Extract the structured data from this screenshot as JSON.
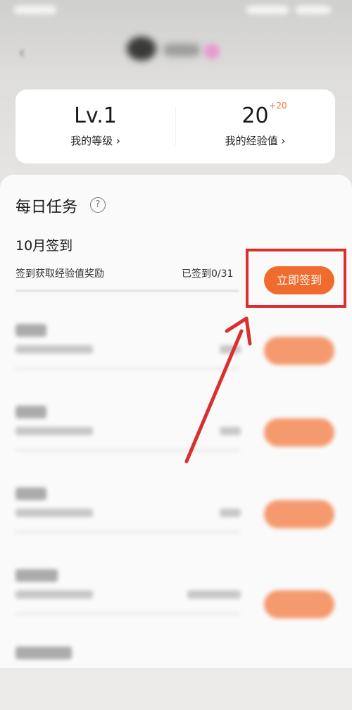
{
  "level": {
    "value": "Lv.1",
    "label": "我的等级 ›"
  },
  "experience": {
    "value": "20",
    "increment": "+20",
    "label": "我的经验值 ›"
  },
  "tasks": {
    "title": "每日任务",
    "help_symbol": "?"
  },
  "checkin": {
    "title": "10月签到",
    "description": "签到获取经验值奖励",
    "status": "已签到0/31",
    "progress": 0,
    "button_label": "立即签到"
  },
  "colors": {
    "accent": "#f06b2e",
    "annotation": "#d9302f"
  }
}
